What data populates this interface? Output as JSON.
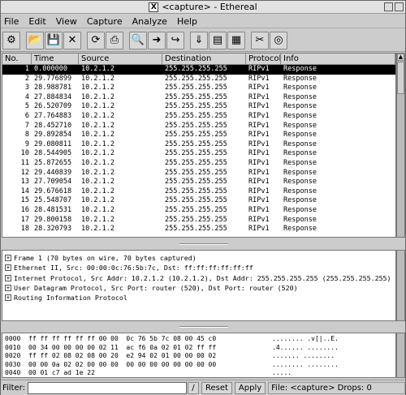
{
  "window": {
    "title": "<capture> - Ethereal",
    "x_logo": "X"
  },
  "menu": [
    "File",
    "Edit",
    "View",
    "Capture",
    "Analyze",
    "Help"
  ],
  "toolbar": [
    {
      "icon": "capture-options-icon",
      "glyph": "⚙"
    },
    {
      "icon": "open-icon",
      "glyph": "📂"
    },
    {
      "icon": "save-icon",
      "glyph": "💾"
    },
    {
      "icon": "close-icon",
      "glyph": "✕"
    },
    {
      "icon": "reload-icon",
      "glyph": "⟳"
    },
    {
      "icon": "print-icon",
      "glyph": "⎙"
    },
    {
      "icon": "find-icon",
      "glyph": "🔍"
    },
    {
      "icon": "go-forward-icon",
      "glyph": "➜"
    },
    {
      "icon": "go-to-packet-icon",
      "glyph": "↪"
    },
    {
      "icon": "display-filter-icon",
      "glyph": "⇓"
    },
    {
      "icon": "color-filter-icon",
      "glyph": "▤"
    },
    {
      "icon": "preferences-icon",
      "glyph": "▦"
    },
    {
      "icon": "tools-icon",
      "glyph": "✂"
    },
    {
      "icon": "help-icon",
      "glyph": "◎"
    }
  ],
  "columns": [
    "No.",
    "Time",
    "Source",
    "Destination",
    "Protocol",
    "Info"
  ],
  "packets": [
    {
      "no": "1",
      "time": "0.000000",
      "src": "10.2.1.2",
      "dst": "255.255.255.255",
      "proto": "RIPv1",
      "info": "Response"
    },
    {
      "no": "2",
      "time": "29.776899",
      "src": "10.2.1.2",
      "dst": "255.255.255.255",
      "proto": "RIPv1",
      "info": "Response"
    },
    {
      "no": "3",
      "time": "28.988781",
      "src": "10.2.1.2",
      "dst": "255.255.255.255",
      "proto": "RIPv1",
      "info": "Response"
    },
    {
      "no": "4",
      "time": "27.884834",
      "src": "10.2.1.2",
      "dst": "255.255.255.255",
      "proto": "RIPv1",
      "info": "Response"
    },
    {
      "no": "5",
      "time": "26.520709",
      "src": "10.2.1.2",
      "dst": "255.255.255.255",
      "proto": "RIPv1",
      "info": "Response"
    },
    {
      "no": "6",
      "time": "27.764883",
      "src": "10.2.1.2",
      "dst": "255.255.255.255",
      "proto": "RIPv1",
      "info": "Response"
    },
    {
      "no": "7",
      "time": "28.452710",
      "src": "10.2.1.2",
      "dst": "255.255.255.255",
      "proto": "RIPv1",
      "info": "Response"
    },
    {
      "no": "8",
      "time": "29.892854",
      "src": "10.2.1.2",
      "dst": "255.255.255.255",
      "proto": "RIPv1",
      "info": "Response"
    },
    {
      "no": "9",
      "time": "29.080811",
      "src": "10.2.1.2",
      "dst": "255.255.255.255",
      "proto": "RIPv1",
      "info": "Response"
    },
    {
      "no": "10",
      "time": "28.544905",
      "src": "10.2.1.2",
      "dst": "255.255.255.255",
      "proto": "RIPv1",
      "info": "Response"
    },
    {
      "no": "11",
      "time": "25.872655",
      "src": "10.2.1.2",
      "dst": "255.255.255.255",
      "proto": "RIPv1",
      "info": "Response"
    },
    {
      "no": "12",
      "time": "29.440839",
      "src": "10.2.1.2",
      "dst": "255.255.255.255",
      "proto": "RIPv1",
      "info": "Response"
    },
    {
      "no": "13",
      "time": "27.709054",
      "src": "10.2.1.2",
      "dst": "255.255.255.255",
      "proto": "RIPv1",
      "info": "Response"
    },
    {
      "no": "14",
      "time": "29.676618",
      "src": "10.2.1.2",
      "dst": "255.255.255.255",
      "proto": "RIPv1",
      "info": "Response"
    },
    {
      "no": "15",
      "time": "25.548707",
      "src": "10.2.1.2",
      "dst": "255.255.255.255",
      "proto": "RIPv1",
      "info": "Response"
    },
    {
      "no": "16",
      "time": "28.481531",
      "src": "10.2.1.2",
      "dst": "255.255.255.255",
      "proto": "RIPv1",
      "info": "Response"
    },
    {
      "no": "17",
      "time": "29.800158",
      "src": "10.2.1.2",
      "dst": "255.255.255.255",
      "proto": "RIPv1",
      "info": "Response"
    },
    {
      "no": "18",
      "time": "28.320793",
      "src": "10.2.1.2",
      "dst": "255.255.255.255",
      "proto": "RIPv1",
      "info": "Response"
    }
  ],
  "details": [
    "Frame 1 (70 bytes on wire, 70 bytes captured)",
    "Ethernet II, Src: 00:00:0c:76:5b:7c, Dst: ff:ff:ff:ff:ff:ff",
    "Internet Protocol, Src Addr: 10.2.1.2 (10.2.1.2), Dst Addr: 255.255.255.255 (255.255.255.255)",
    "User Datagram Protocol, Src Port: router (520), Dst Port: router (520)",
    "Routing Information Protocol"
  ],
  "hex": [
    {
      "off": "0000",
      "bytes": "ff ff ff ff ff ff 00 00  0c 76 5b 7c 08 00 45 c0",
      "ascii": "........ .v[|..E."
    },
    {
      "off": "0010",
      "bytes": "00 34 00 00 00 00 02 11  ac f6 0a 02 01 02 ff ff",
      "ascii": ".4...... ........"
    },
    {
      "off": "0020",
      "bytes": "ff ff 02 08 02 08 00 20  e2 94 02 01 00 00 00 02",
      "ascii": "....... ........"
    },
    {
      "off": "0030",
      "bytes": "00 00 0a 02 02 00 00 00  00 00 00 00 00 00 00 00",
      "ascii": "........ ........"
    },
    {
      "off": "0040",
      "bytes": "00 01 c7 ad 1e 22",
      "ascii": "....."
    }
  ],
  "status": {
    "filter_label": "Filter:",
    "filter_value": "",
    "reset_label": "Reset",
    "apply_label": "Apply",
    "status_text": "File: <capture>  Drops: 0"
  },
  "colors": {
    "selected_row_bg": "#000000",
    "selected_row_fg": "#ffffff"
  }
}
